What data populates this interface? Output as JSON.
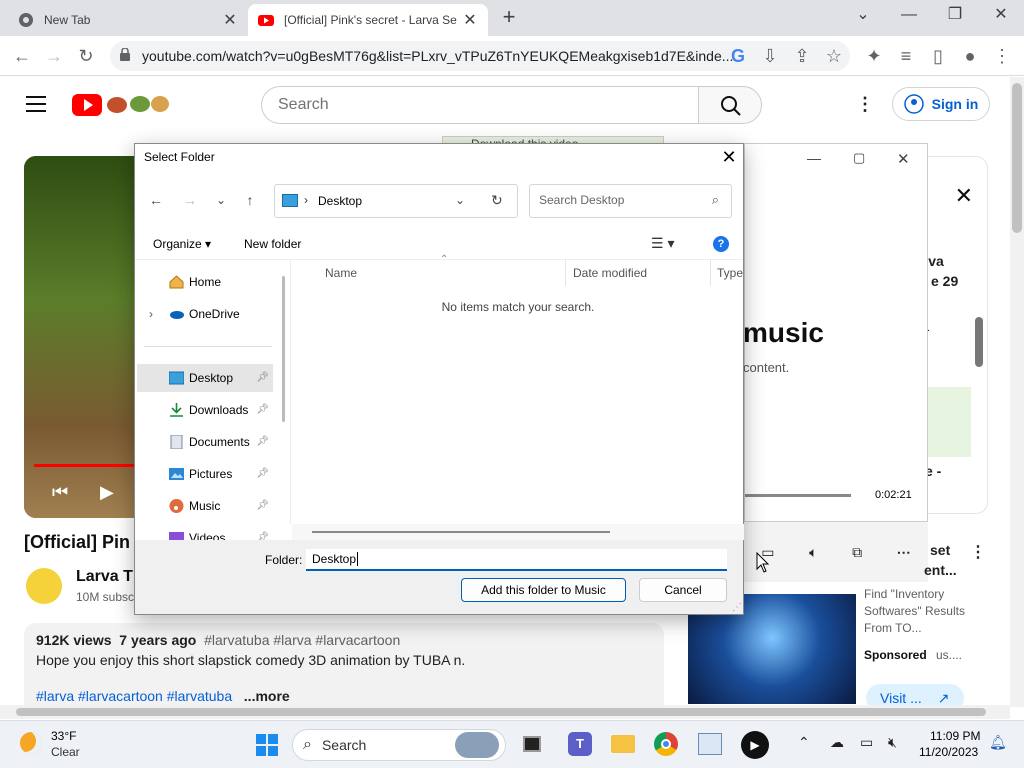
{
  "browser": {
    "tabs": [
      {
        "title": "New Tab"
      },
      {
        "title": "[Official] Pink's secret - Larva Se"
      }
    ],
    "url": "youtube.com/watch?v=u0gBesMT76g&list=PLxrv_vTPuZ6TnYEUKQEMeakgxiseb1d7E&inde..."
  },
  "youtube": {
    "search_placeholder": "Search",
    "signin_label": "Sign in",
    "video_title": "[Official] Pin",
    "channel_name": "Larva T",
    "subscribers": "10M subsc",
    "views": "912K views",
    "age": "7 years ago",
    "tags": "#larvatuba #larva #larvacartoon",
    "description": "Hope you enjoy this short slapstick comedy 3D animation by TUBA n.",
    "desc_tags": "#larva #larvacartoon #larvatuba",
    "more_label": "...more",
    "download_banner": "Download this video",
    "panel": {
      "right_text1": "arva",
      "right_text2": "e 29",
      "music_heading": "music",
      "content_text": "content.",
      "dash": "-",
      "e_dash": "e -",
      "time": "0:02:21",
      "rec_title1": "set",
      "rec_title2": "ent...",
      "ad_text": "Find \"Inventory Softwares\" Results From TO...",
      "sponsored": "Sponsored",
      "sponsor_domain": "us....",
      "visit_label": "Visit ..."
    }
  },
  "dialog": {
    "title": "Select Folder",
    "address": "Desktop",
    "search_placeholder": "Search Desktop",
    "organize_label": "Organize",
    "new_folder_label": "New folder",
    "nav_items": [
      {
        "label": "Home"
      },
      {
        "label": "OneDrive"
      },
      {
        "label": "Desktop"
      },
      {
        "label": "Downloads"
      },
      {
        "label": "Documents"
      },
      {
        "label": "Pictures"
      },
      {
        "label": "Music"
      },
      {
        "label": "Videos"
      }
    ],
    "columns": [
      "Name",
      "Date modified",
      "Type"
    ],
    "empty_message": "No items match your search.",
    "folder_label": "Folder:",
    "folder_value": "Desktop",
    "add_button": "Add this folder to Music",
    "cancel_button": "Cancel"
  },
  "taskbar": {
    "temperature": "33°F",
    "condition": "Clear",
    "search_label": "Search",
    "time": "11:09 PM",
    "date": "11/20/2023"
  },
  "colors": {
    "accent": "#005fb8",
    "youtube_red": "#ff0000",
    "signin_blue": "#065fd4"
  }
}
